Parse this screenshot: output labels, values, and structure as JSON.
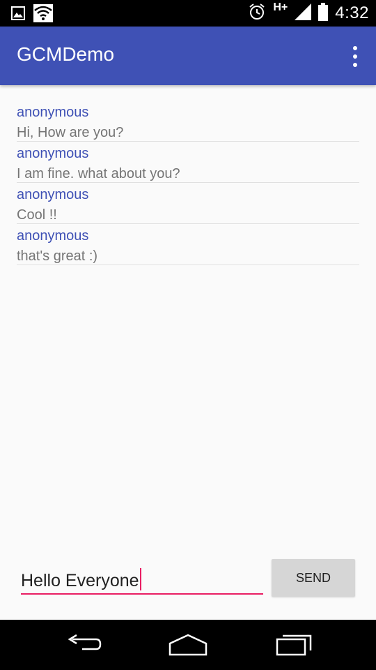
{
  "status_bar": {
    "time": "4:32",
    "network": "H+",
    "icons": [
      "image-icon",
      "wifi-icon",
      "alarm-icon",
      "signal-icon",
      "battery-icon"
    ]
  },
  "app_bar": {
    "title": "GCMDemo",
    "overflow_icon": "more-vert-icon",
    "color": "#3F51B5"
  },
  "messages": [
    {
      "sender": "anonymous",
      "text": "Hi, How are you?"
    },
    {
      "sender": "anonymous",
      "text": "I am fine. what about you?"
    },
    {
      "sender": "anonymous",
      "text": "Cool !!"
    },
    {
      "sender": "anonymous",
      "text": "that's great :)"
    }
  ],
  "compose": {
    "input_value": "Hello Everyone",
    "send_label": "SEND",
    "accent": "#E91E63"
  },
  "nav_bar": {
    "icons": [
      "back-icon",
      "home-icon",
      "recents-icon"
    ]
  }
}
